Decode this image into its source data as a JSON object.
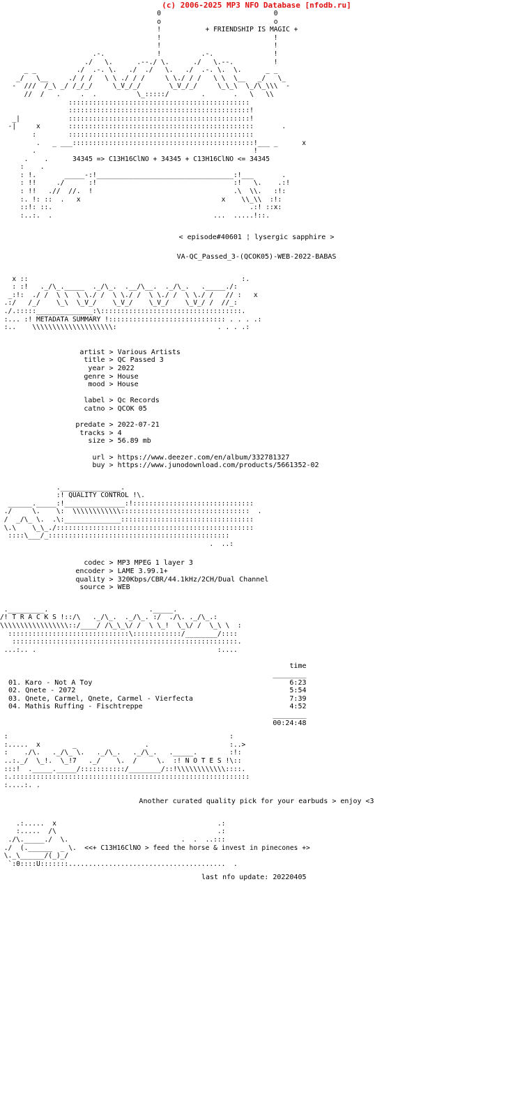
{
  "header": {
    "copyright": "(c) 2006-2025 MP3 NFO Database [nfodb.ru]",
    "accent_color": "#e01010"
  },
  "banner": {
    "tagline": "+ FRIENDSHIP IS MAGIC +",
    "logo_art": "                                       0                            0\n                                       o                            o\n                                       !           + FRIENDSHIP IS MAGIC +\n                                       !                            !\n                                       !                            !\n                       .-.             !          .-.               !\n                     ./   \\.      .--./ \\.      ./   \\.--.          !\n      _ _          ./  .-. \\.   ./  ./   \\.   ./  .-. \\.  \\.      _ _\n    _/   \\__     ./ / /   \\ \\ ./ / /     \\ \\./ / /   \\ \\  \\__   _/   \\_\n   -  ///  /_\\ _/ /_/_/     \\_V_/_/       \\_V_/_/     \\_\\_\\  \\_/\\_\\\\\\  -\n      //  /   .     .  .          \\_:::::/        .       .   \\   \\\\\n                 :::::::::::::::::::::::::::::::::::::::::::::\n                 :::::::::::::::::::::::::::::::::::::::::::::!\n   _|            :::::::::::::::::::::::::::::::::::::::::::::!\n  -|     x       ::::::::::::::::::::::::::::::::::::::::::::::       .\n        :        ::::::::::::::::::::::::::::::::::::::::::::::\n         .   _ ___:::::::::::::::::::::::::::::::::::::::::::::!___ _      x\n        .                                                      !\n      .    .      34345 => C13H16ClNO + 34345 + C13H16ClNO <= 34345\n     :    .\n     : !.       _____-:!__________________________________:!___       .\n     : !!     ./      :!                                  :!   \\.    .:!\n     : !!   .//  //.  !                                   .\\  \\\\.   :!:\n     :. !: ::  .   x                                   x    \\\\_\\\\  :!:\n     ::!: ::.                                                 .:! ::x:\n     :..:.  .                                        ...  .....!::.",
    "episode_line": "< episode#40601 ¦ lysergic sapphire >",
    "release_name": "VA-QC_Passed_3-(QCOK05)-WEB-2022-BABAS"
  },
  "metadata_section": {
    "heading_art": "   x ::                                                     :.\n   : :!   ._/\\_._____  ._/\\_.  .__/\\__.  ._/\\_.   ._____./:\n  _:!:  ./ /  \\ \\  \\ \\./ /  \\ \\./ /  \\ \\./ /  \\ \\./ /   // :   x\n .:/   /_/    \\_\\  \\_V_/    \\_V_/    \\_V_/    \\_V_/ /  //_:\n ./.:::::______________:\\:::::::::::::::::::::::::::::::::::.\n :... :! METADATA SUMMARY !::::::::::::::::::::::::::::: . . . .:\n :..    \\\\\\\\\\\\\\\\\\\\\\\\\\\\\\\\\\\\\\\\:                         . . . .:",
    "heading_label": "METADATA SUMMARY",
    "fields": [
      {
        "label": "artist",
        "value": "Various Artists"
      },
      {
        "label": "title",
        "value": "QC Passed 3"
      },
      {
        "label": "year",
        "value": "2022"
      },
      {
        "label": "genre",
        "value": "House"
      },
      {
        "label": "mood",
        "value": "House"
      },
      {
        "label": "label",
        "value": "Qc Records"
      },
      {
        "label": "catno",
        "value": "QCOK 05"
      },
      {
        "label": "predate",
        "value": "2022-07-21"
      },
      {
        "label": "tracks",
        "value": "4"
      },
      {
        "label": "size",
        "value": "56.89 mb"
      },
      {
        "label": "url",
        "value": "https://www.deezer.com/en/album/332781327"
      },
      {
        "label": "buy",
        "value": "https://www.junodownload.com/products/5661352-02"
      }
    ]
  },
  "quality_section": {
    "heading_art": "              ._______________.\n              :! QUALITY CONTROL !\\.\n  ______._____:!_______________:!::::::::::::::::::::::::::::::\n ./     \\.    \\:  \\\\\\\\\\\\\\\\\\\\\\\\::::::::::::::::::::::::::::::::  .\n /  _/\\_ \\.  .\\:______________:::::::::::::::::::::::::::::::::\n \\.\\    \\_\\_./:::::::::::::::::::::::::::::::::::::::::::::::::\n  ::::\\___/_:::::::::::::::::::::::::::::::::::::::::::::\n                                                    .  ..:",
    "heading_label": "QUALITY CONTROL",
    "fields": [
      {
        "label": "codec",
        "value": "MP3 MPEG 1 layer 3"
      },
      {
        "label": "encoder",
        "value": "LAME 3.99.1+"
      },
      {
        "label": "quality",
        "value": "320Kbps/CBR/44.1kHz/2CH/Dual Channel"
      },
      {
        "label": "source",
        "value": "WEB"
      }
    ]
  },
  "tracks_section": {
    "heading_art": " ._________.                         ._____.\n/! T R A C K S !::/\\   ._/\\_.  ._/\\_. :/  ./\\. ._/\\_.:\n\\\\\\\\\\\\\\\\\\\\\\\\\\\\\\\\\\::/____/ /\\_\\_\\/ /  \\ \\_!  \\_\\/ /  \\_\\ \\  :\n  ::::::::::::::::::::::::::::::\\::::::::::::/________/::::\n   ::::::::::::::::::::::::::::::::::::::::::::::::::::::::.\n ...:.. .                                             :....",
    "heading_label": "T R A C K S",
    "time_column_header": "time",
    "tracks": [
      {
        "num": "01.",
        "title": "Karo - Not A Toy",
        "time": "6:23"
      },
      {
        "num": "02.",
        "title": "Qnete - 2072",
        "time": "5:54"
      },
      {
        "num": "03.",
        "title": "Qnete, Carmel, Qnete, Carmel - Vierfecta",
        "time": "7:39"
      },
      {
        "num": "04.",
        "title": "Mathis Ruffing - Fischtreppe",
        "time": "4:52"
      }
    ],
    "total_time": "00:24:48"
  },
  "notes_section": {
    "heading_art": " :                                                       :\n :.....  x        _                 .                    :..>\n :    ./\\.   ._/\\_ \\.   ._/\\_.   ._/\\_.   ._____.        :!:\n ..:._/  \\_!.  \\_!7   ._/    \\.  /     \\.  :! N O T E S !\\::\n :::!  ._____._____/:::::::::::/________/::!\\\\\\\\\\\\\\\\\\\\\\\\::::.\n :.:::::::::::::::::::::::::::::::::::::::::::::::::::::::::::\n :....:. .",
    "heading_label": "N O T E S",
    "note_text": "Another curated quality pick for your earbuds > enjoy <3"
  },
  "footer": {
    "art": "    .:.....  x                                        .:\n    :.....  /\\                                        .:\n  ./\\._____./  \\.                            .  .  ..:::\n ./  (.______  _ \\.  <<+ C13H16ClNO > feed the horse & invest in pinecones +>\n \\._\\______/(_)_/\n  `:0::::U:::::::.......................................  .",
    "slogan": "<<+ C13H16ClNO > feed the horse & invest in pinecones +>",
    "last_update_label": "last nfo update:",
    "last_update_value": "20220405"
  }
}
